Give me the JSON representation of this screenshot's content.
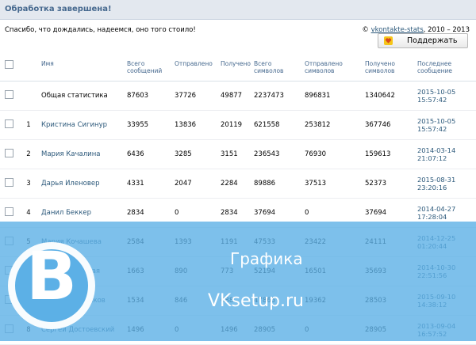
{
  "header": {
    "title": "Обработка завершена!"
  },
  "message": "Спасибо, что дождались, надеемся, оно того стоило!",
  "copyright": {
    "symbol": "©",
    "link": "vkontakte-stats",
    "years": ", 2010 – 2013"
  },
  "support_button": {
    "label": "Поддержать",
    "icon": "heart-badge-icon"
  },
  "table": {
    "columns": [
      "",
      "",
      "Имя",
      "Всего сообщений",
      "Отправлено",
      "Получено",
      "Всего символов",
      "Отправлено символов",
      "Получено символов",
      "Последнее сообщение"
    ],
    "rows": [
      {
        "num": "",
        "name": "Общая статистика",
        "total": "87603",
        "sent": "37726",
        "recv": "49877",
        "chars": "2237473",
        "sent_chars": "896831",
        "recv_chars": "1340642",
        "date": "2015-10-05",
        "time": "15:57:42"
      },
      {
        "num": "1",
        "name": "Кристина Сигинур",
        "total": "33955",
        "sent": "13836",
        "recv": "20119",
        "chars": "621558",
        "sent_chars": "253812",
        "recv_chars": "367746",
        "date": "2015-10-05",
        "time": "15:57:42"
      },
      {
        "num": "2",
        "name": "Мария Качалина",
        "total": "6436",
        "sent": "3285",
        "recv": "3151",
        "chars": "236543",
        "sent_chars": "76930",
        "recv_chars": "159613",
        "date": "2014-03-14",
        "time": "21:07:12"
      },
      {
        "num": "3",
        "name": "Дарья Иленовер",
        "total": "4331",
        "sent": "2047",
        "recv": "2284",
        "chars": "89886",
        "sent_chars": "37513",
        "recv_chars": "52373",
        "date": "2015-08-31",
        "time": "23:20:16"
      },
      {
        "num": "4",
        "name": "Данил Беккер",
        "total": "2834",
        "sent": "0",
        "recv": "2834",
        "chars": "37694",
        "sent_chars": "0",
        "recv_chars": "37694",
        "date": "2014-04-27",
        "time": "17:28:04"
      },
      {
        "num": "5",
        "name": "Мария Кочашева",
        "total": "2584",
        "sent": "1393",
        "recv": "1191",
        "chars": "47533",
        "sent_chars": "23422",
        "recv_chars": "24111",
        "date": "2014-12-25",
        "time": "01:20:44"
      },
      {
        "num": "6",
        "name": "Любовь Дуковая",
        "total": "1663",
        "sent": "890",
        "recv": "773",
        "chars": "52194",
        "sent_chars": "16501",
        "recv_chars": "35693",
        "date": "2014-10-30",
        "time": "22:51:56"
      },
      {
        "num": "7",
        "name": "Андрей Бережков",
        "total": "1534",
        "sent": "846",
        "recv": "688",
        "chars": "47865",
        "sent_chars": "19362",
        "recv_chars": "28503",
        "date": "2015-09-10",
        "time": "14:38:12"
      },
      {
        "num": "8",
        "name": "Сергей Достоевский",
        "total": "1496",
        "sent": "0",
        "recv": "1496",
        "chars": "28905",
        "sent_chars": "0",
        "recv_chars": "28905",
        "date": "2013-09-04",
        "time": "16:57:52"
      }
    ]
  },
  "watermark": {
    "logo_letter": "B",
    "caption": "Графика",
    "site": "VKsetup.ru"
  },
  "colors": {
    "link": "#2b587a",
    "header_bg": "#e3e8ef",
    "overlay": "#5cb0e6"
  }
}
